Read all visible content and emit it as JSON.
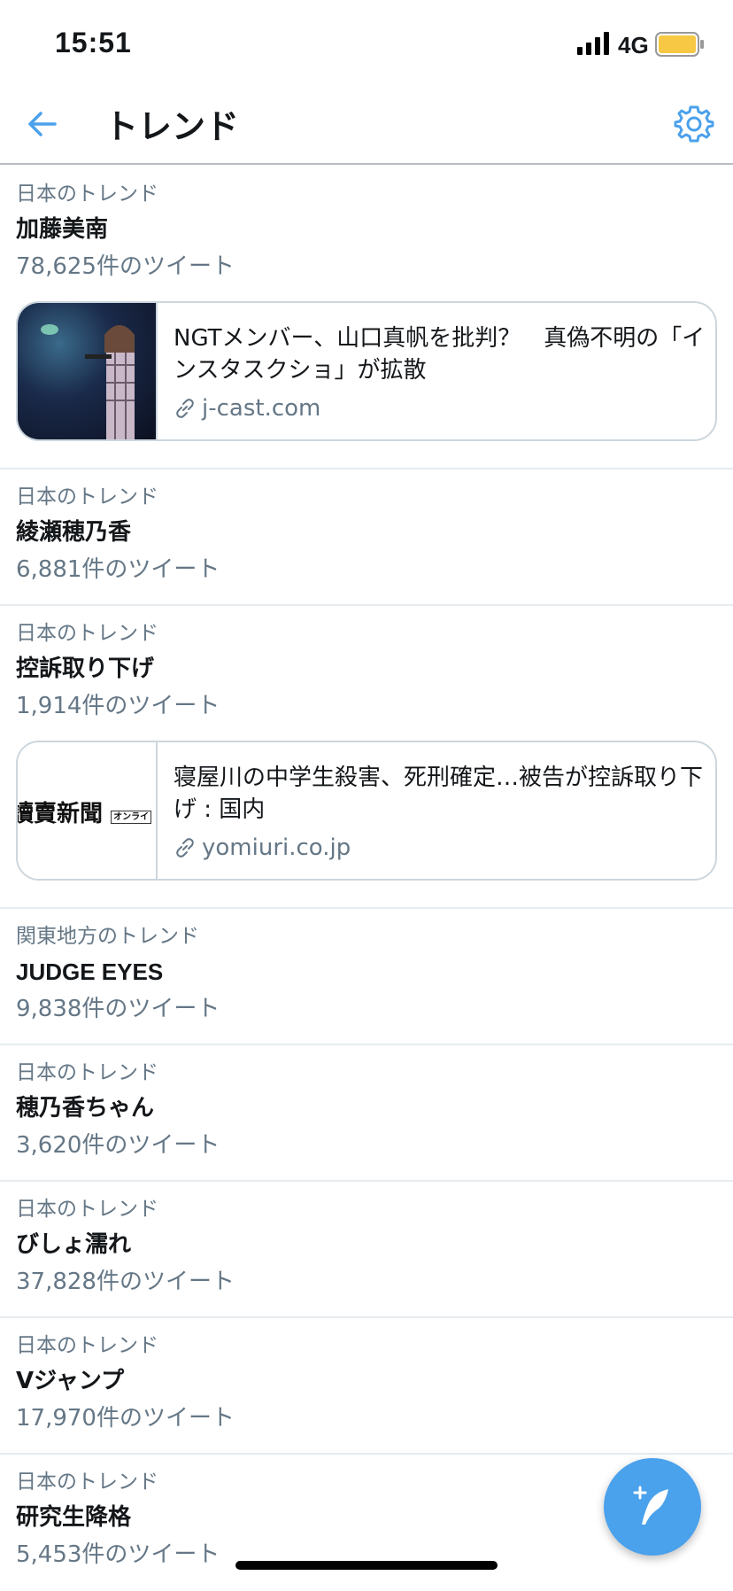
{
  "status": {
    "time": "15:51",
    "network": "4G",
    "battery_color": "#f6c843"
  },
  "nav": {
    "title": "トレンド",
    "accent_color": "#4aa1ec"
  },
  "trends": [
    {
      "context": "日本のトレンド",
      "name": "加藤美南",
      "count": "78,625件のツイート",
      "card": {
        "headline": "NGTメンバー、山口真帆を批判？　真偽不明の「インスタスクショ」が拡散",
        "domain": "j-cast.com",
        "thumb": "concert-photo"
      }
    },
    {
      "context": "日本のトレンド",
      "name": "綾瀬穂乃香",
      "count": "6,881件のツイート"
    },
    {
      "context": "日本のトレンド",
      "name": "控訴取り下げ",
      "count": "1,914件のツイート",
      "card": {
        "headline": "寝屋川の中学生殺害、死刑確定…被告が控訴取り下げ : 国内",
        "domain": "yomiuri.co.jp",
        "thumb": "yomiuri-logo",
        "logo_text": "讀賣新聞",
        "logo_tag": "オンライ"
      }
    },
    {
      "context": "関東地方のトレンド",
      "name": "JUDGE EYES",
      "count": "9,838件のツイート"
    },
    {
      "context": "日本のトレンド",
      "name": "穂乃香ちゃん",
      "count": "3,620件のツイート"
    },
    {
      "context": "日本のトレンド",
      "name": "びしょ濡れ",
      "count": "37,828件のツイート"
    },
    {
      "context": "日本のトレンド",
      "name": "Vジャンプ",
      "count": "17,970件のツイート"
    },
    {
      "context": "日本のトレンド",
      "name": "研究生降格",
      "count": "5,453件のツイート"
    }
  ],
  "fab": {
    "icon": "compose-tweet-icon"
  }
}
